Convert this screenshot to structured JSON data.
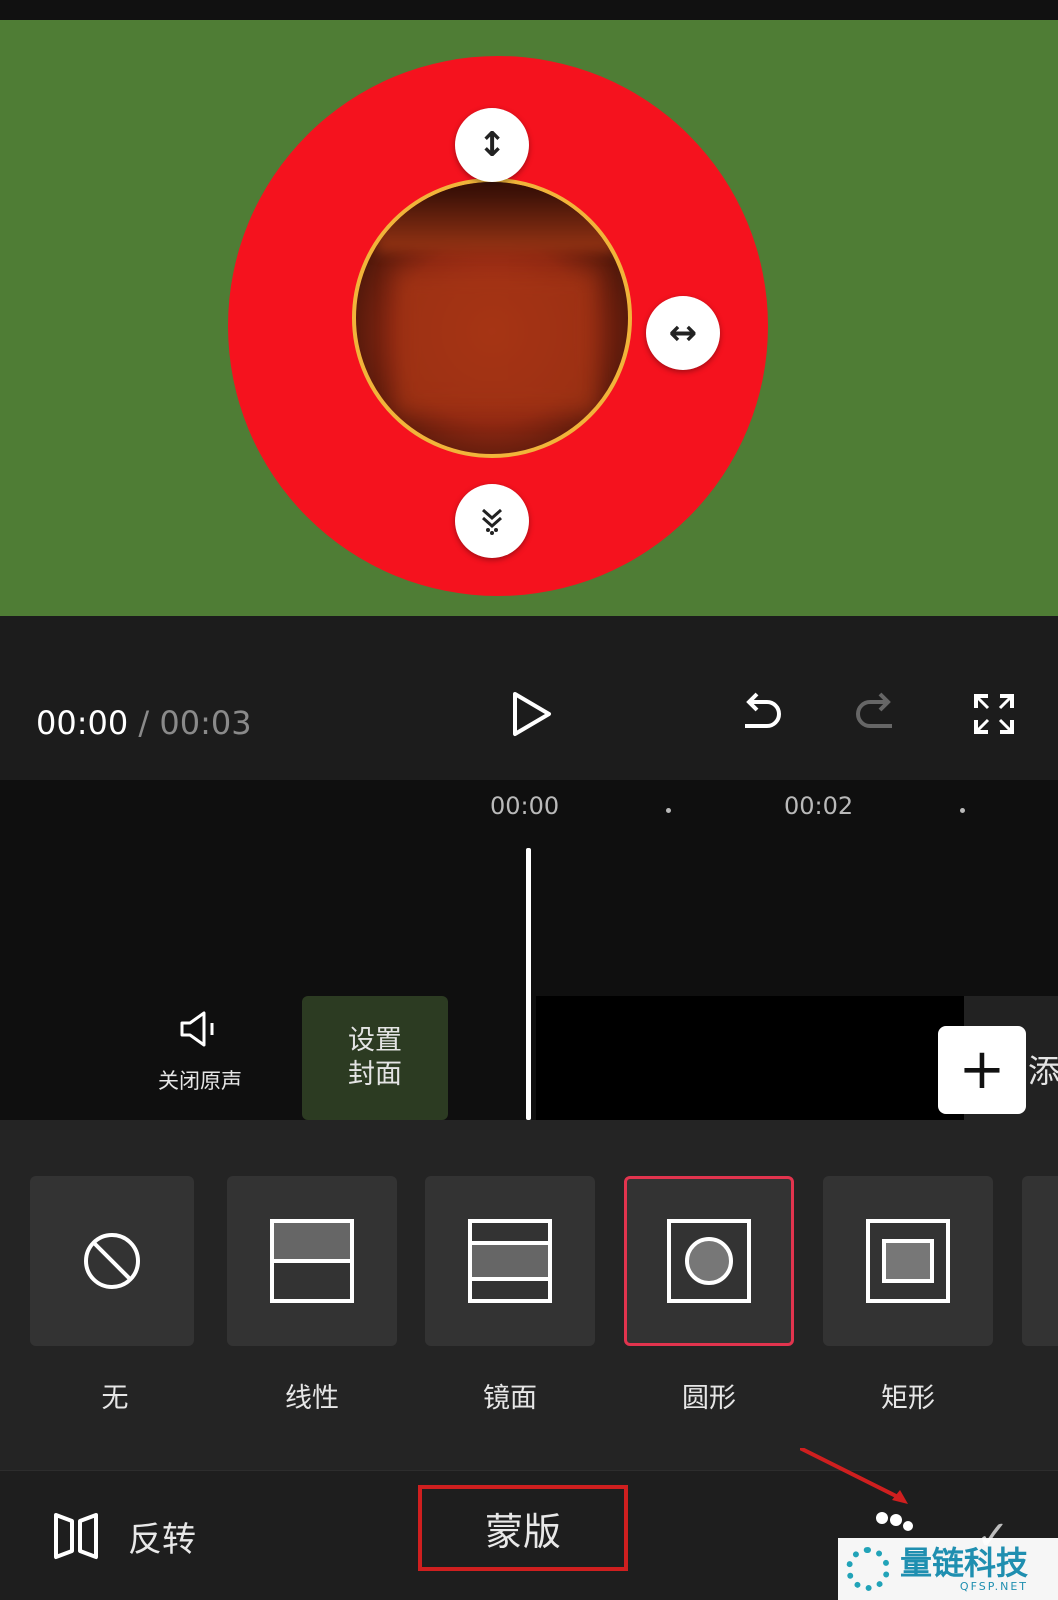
{
  "player": {
    "current_time": "00:00",
    "separator": "/",
    "total_time": "00:03"
  },
  "timeline": {
    "ruler": [
      "00:00",
      "00:02"
    ],
    "mute_label": "关闭原声",
    "cover_label_line1": "设置",
    "cover_label_line2": "封面",
    "add_label": "添"
  },
  "mask_options": {
    "items": [
      {
        "label": "无",
        "icon": "none-icon",
        "selected": false
      },
      {
        "label": "线性",
        "icon": "linear-mask-icon",
        "selected": false
      },
      {
        "label": "镜面",
        "icon": "mirror-mask-icon",
        "selected": false
      },
      {
        "label": "圆形",
        "icon": "circle-mask-icon",
        "selected": true
      },
      {
        "label": "矩形",
        "icon": "rectangle-mask-icon",
        "selected": false
      }
    ]
  },
  "bottom_bar": {
    "reverse_label": "反转",
    "title": "蒙版",
    "confirm_icon": "check-icon"
  },
  "watermark": {
    "title": "量链科技",
    "subtitle": "QFSP.NET"
  },
  "colors": {
    "preview_bg": "#4f7d35",
    "mask_ring": "#f5121e",
    "selected_border": "#e2344e",
    "annotation_red": "#cf1f1f"
  }
}
